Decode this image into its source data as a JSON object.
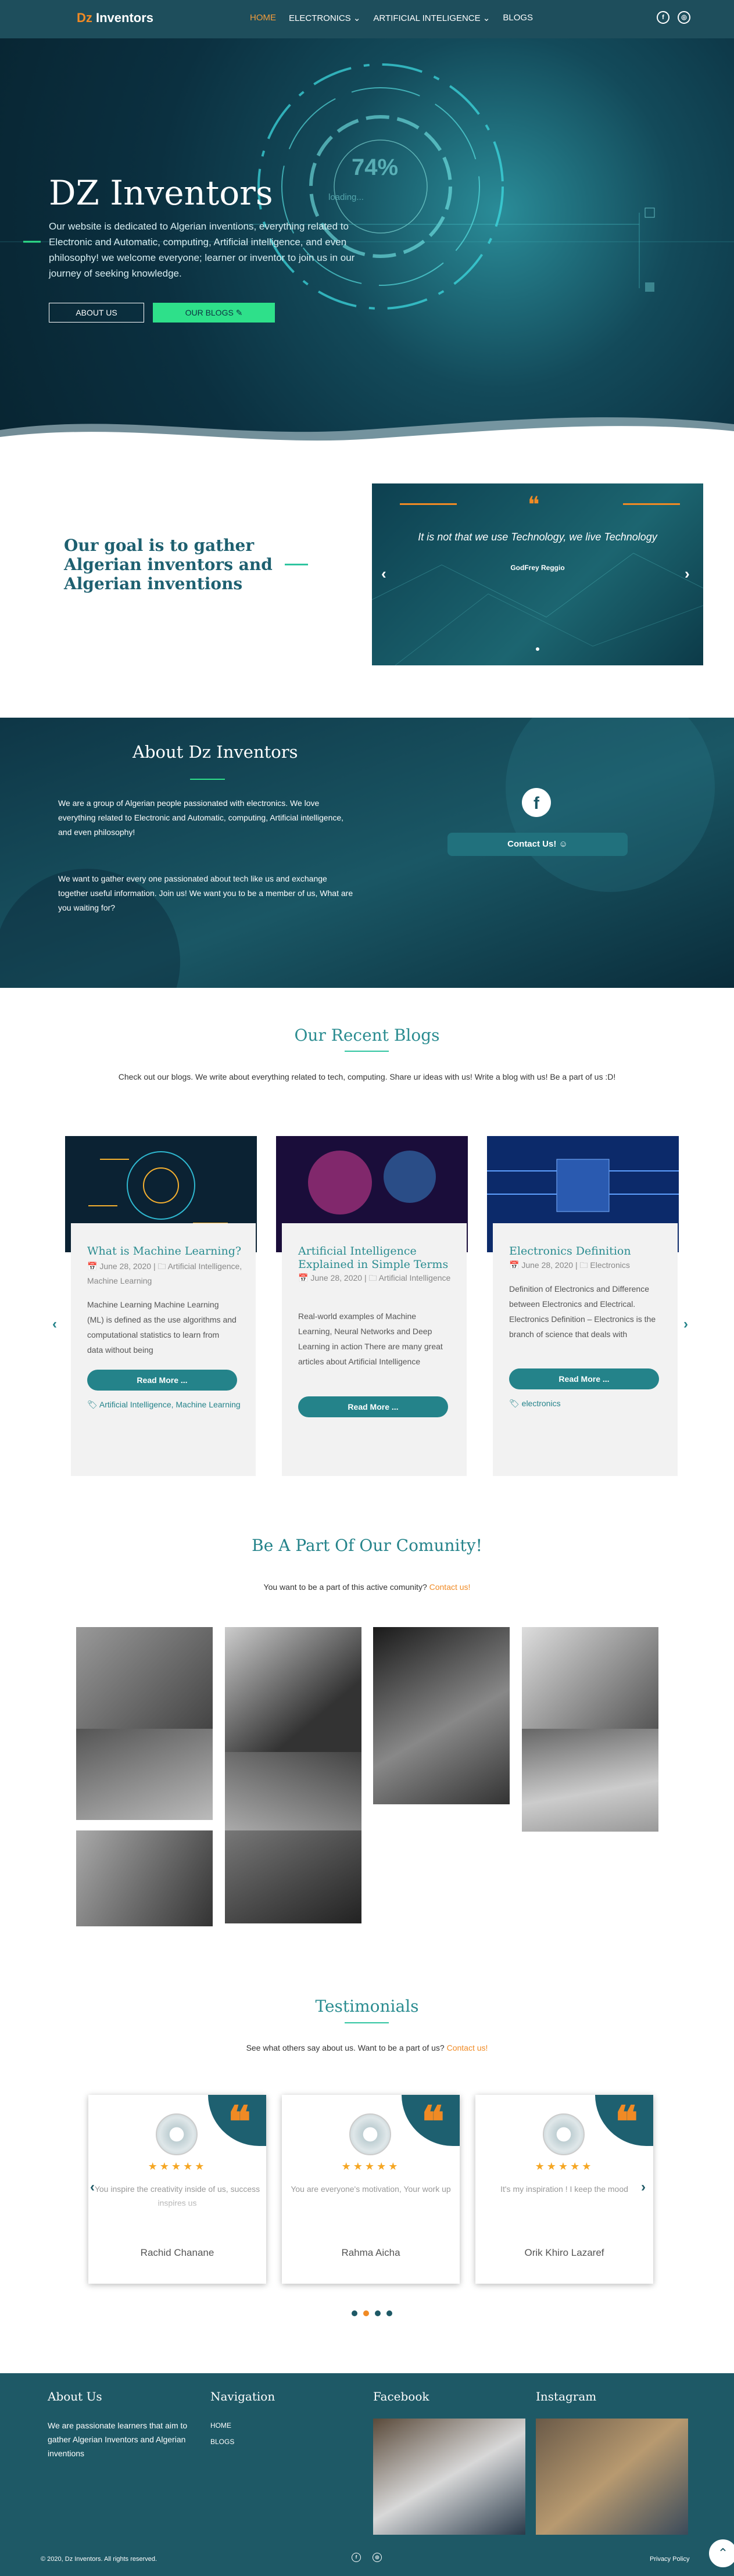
{
  "nav": {
    "logo_dz": "Dz",
    "logo_rest": " Inventors",
    "items": [
      {
        "label": "HOME"
      },
      {
        "label": "ELECTRONICS ⌄"
      },
      {
        "label": "ARTIFICIAL INTELIGENCE ⌄"
      },
      {
        "label": "BLOGS"
      }
    ],
    "social": [
      {
        "icon": "facebook-icon",
        "glyph": "f"
      },
      {
        "icon": "instagram-icon",
        "glyph": "◎"
      }
    ]
  },
  "hero": {
    "title": "DZ Inventors",
    "description": "Our website is dedicated to Algerian inventions, everything related to Electronic and Automatic, computing, Artificial intelligence, and even philosophy! we welcome everyone; learner or inventor to join us in our journey of seeking knowledge.",
    "about_button": "ABOUT US",
    "blogs_button": "OUR BLOGS",
    "percent": "74%",
    "loading": "loading..."
  },
  "goal": {
    "heading": "Our goal is to gather Algerian inventors and Algerian inventions"
  },
  "quote": {
    "mark": "❝",
    "text": "It is not that we use Technology, we live Technology",
    "author": "GodFrey Reggio"
  },
  "about": {
    "title": "About Dz Inventors",
    "p1": "We are a group of Algerian people passionated with electronics. We love everything related to Electronic and Automatic, computing, Artificial intelligence, and even philosophy!",
    "p2": "We want to gather every one passionated about tech like us and exchange together useful information. Join us! We want you to be a member of us, What are you waiting for?",
    "contact_button": "Contact Us!"
  },
  "blogs": {
    "title": "Our Recent Blogs",
    "subtitle": "Check out our blogs. We write about everything related to tech, computing. Share ur ideas with us! Write a blog with us! Be a part of us :D!",
    "cards": [
      {
        "title": "What is Machine Learning?",
        "meta": "📅 June 28, 2020 | 🗀 Artificial Intelligence, Machine Learning",
        "excerpt": "Machine Learning Machine Learning (ML) is defined as the use algorithms and computational statistics to learn from data without being",
        "read_more": "Read More ...",
        "tags": "🏷 Artificial Intelligence, Machine Learning"
      },
      {
        "title": "Artificial Intelligence Explained in Simple Terms",
        "meta": "📅 June 28, 2020 | 🗀 Artificial Intelligence",
        "excerpt": "Real-world examples of Machine Learning, Neural Networks and Deep Learning in action There are many great articles about Artificial Intelligence",
        "read_more": "Read More ...",
        "tags": ""
      },
      {
        "title": "Electronics Definition",
        "meta": "📅 June 28, 2020 | 🗀 Electronics",
        "excerpt": "Definition of Electronics and Difference between Electronics and Electrical. Electronics Definition – Electronics is the branch of science that deals with",
        "read_more": "Read More ...",
        "tags": "🏷 electronics"
      }
    ]
  },
  "community": {
    "title": "Be A Part Of Our Comunity!",
    "subtitle": "You want to be a part of this active comunity?",
    "link": "Contact us!"
  },
  "testimonials": {
    "title": "Testimonials",
    "subtitle": "See what others say about us. Want to be a part of us?",
    "link": "Contact us!",
    "items": [
      {
        "stars": "★★★★★",
        "quote": "You inspire the creativity inside of us, success inspires us",
        "name": "Rachid Chanane"
      },
      {
        "stars": "★★★★★",
        "quote": "You are everyone's motivation, Your work up",
        "name": "Rahma Aicha"
      },
      {
        "stars": "★★★★★",
        "quote": "It's my inspiration ! I keep the mood",
        "name": "Orik Khiro Lazaref"
      }
    ],
    "quote_mark": "❝"
  },
  "footer": {
    "about_title": "About Us",
    "about_text": "We are passionate learners that aim to gather Algerian Inventors and Algerian inventions",
    "nav_title": "Navigation",
    "nav_links": [
      {
        "label": "HOME"
      },
      {
        "label": "BLOGS"
      }
    ],
    "facebook_title": "Facebook",
    "instagram_title": "Instagram",
    "copyright": "© 2020, Dz Inventors. All rights reserved.",
    "privacy": "Privacy Policy"
  },
  "colors": {
    "accent": "#f08a24",
    "teal": "#24838a",
    "footer": "#1e5966"
  }
}
